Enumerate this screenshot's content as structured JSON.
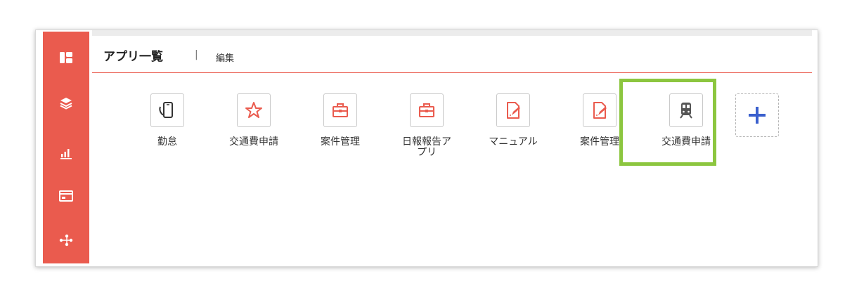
{
  "header": {
    "title": "アプリ一覧",
    "separator": "|",
    "edit_label": "編集"
  },
  "sidebar": {
    "items": [
      {
        "name": "dashboard"
      },
      {
        "name": "layers"
      },
      {
        "name": "analytics"
      },
      {
        "name": "card"
      },
      {
        "name": "network"
      }
    ]
  },
  "apps": [
    {
      "label": "勤怠",
      "icon": "smartphone-icon"
    },
    {
      "label": "交通費申請",
      "icon": "star-icon"
    },
    {
      "label": "案件管理",
      "icon": "briefcase-icon"
    },
    {
      "label": "日報報告ア\nプリ",
      "icon": "briefcase-icon"
    },
    {
      "label": "マニュアル",
      "icon": "document-edit-icon"
    },
    {
      "label": "案件管理",
      "icon": "document-edit-icon"
    },
    {
      "label": "交通費申請",
      "icon": "train-icon"
    }
  ],
  "add_app": {
    "icon": "plus-icon"
  },
  "colors": {
    "accent": "#ea5b4e",
    "highlight": "#8cc63f",
    "plus": "#3a5fcd"
  }
}
